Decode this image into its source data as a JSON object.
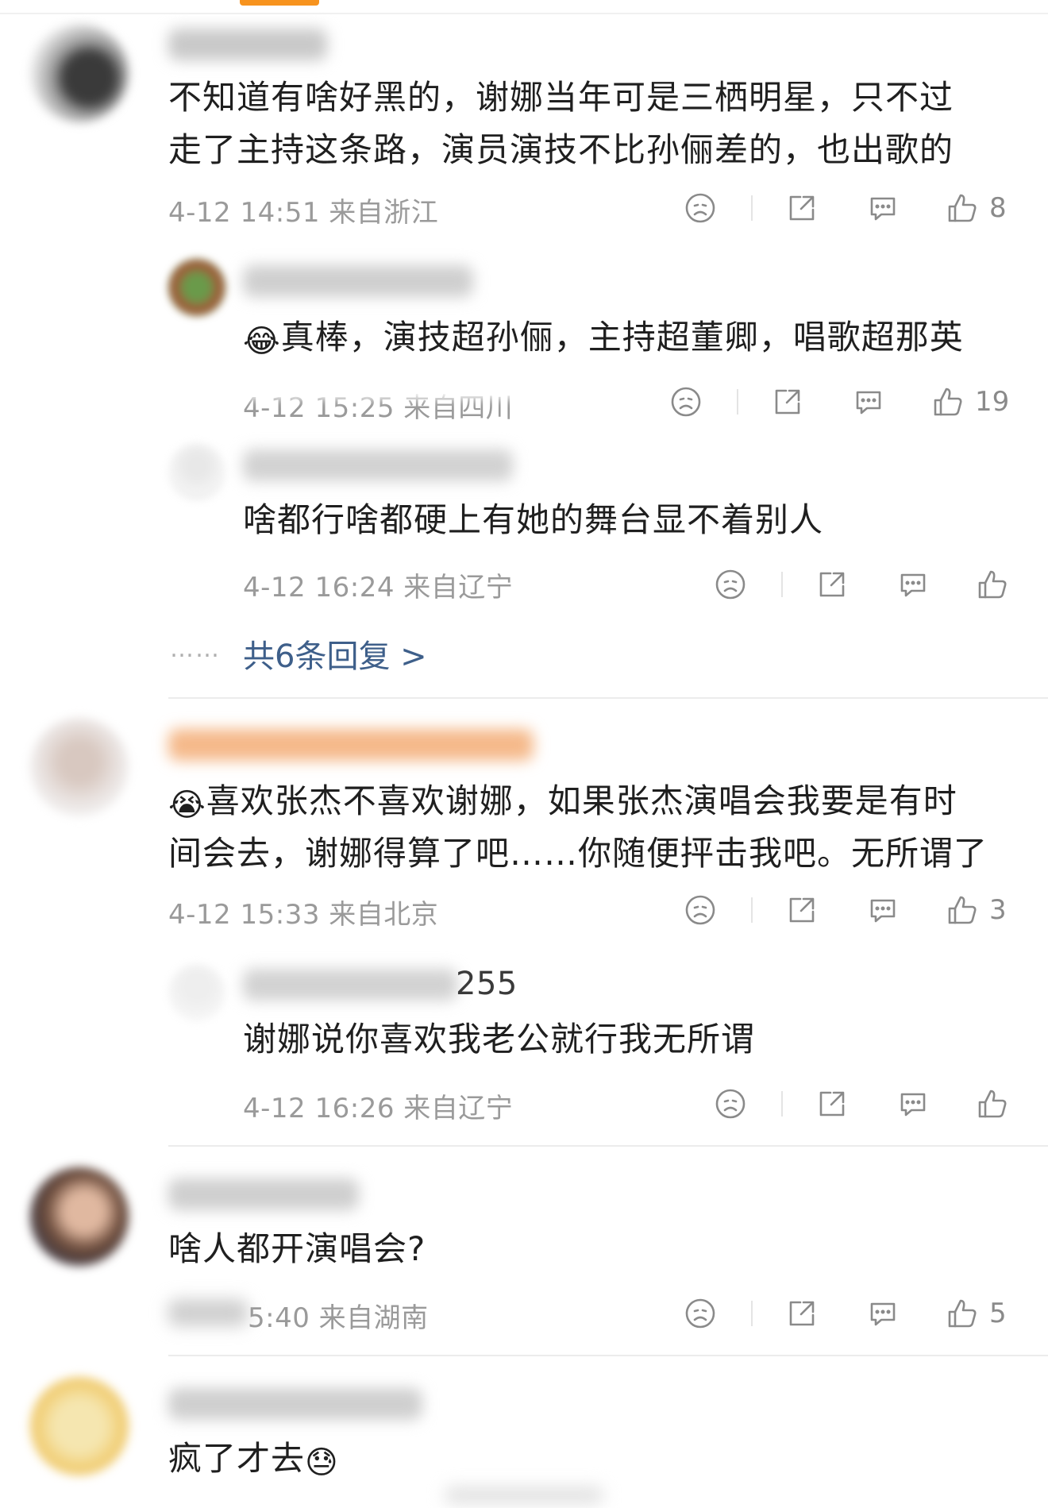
{
  "comments": [
    {
      "text_lines": [
        "不知道有啥好黑的，谢娜当年可是三栖明星，只不过",
        "走了主持这条路，演员演技不比孙俪差的，也出歌的"
      ],
      "meta": "4-12 14:51  来自浙江",
      "likes": "8",
      "replies": [
        {
          "emoji": "😂",
          "text": "真棒，演技超孙俪，主持超董卿，唱歌超那英",
          "meta": "4-12 15:25  来自四川",
          "likes": "19"
        },
        {
          "text": "啥都行啥都硬上有她的舞台显不着别人",
          "meta": "4-12 16:24  来自辽宁",
          "likes": ""
        }
      ],
      "more_replies": "共6条回复 >",
      "more_dots": "……"
    },
    {
      "emoji": "😭",
      "text_lines": [
        "喜欢张杰不喜欢谢娜，如果张杰演唱会我要是有时",
        "间会去，谢娜得算了吧……你随便抨击我吧。无所谓了"
      ],
      "meta": "4-12 15:33  来自北京",
      "likes": "3",
      "replies": [
        {
          "username_tail": "255",
          "text": "谢娜说你喜欢我老公就行我无所谓",
          "meta": "4-12 16:26  来自辽宁",
          "likes": ""
        }
      ]
    },
    {
      "text_lines": [
        "啥人都开演唱会?"
      ],
      "meta": "5:40  来自湖南",
      "likes": "5"
    },
    {
      "text_lines": [
        "疯了才去"
      ],
      "emoji_after": "😓"
    }
  ],
  "icons": [
    "dislike-icon",
    "share-icon",
    "comment-icon",
    "like-icon"
  ],
  "colors": {
    "accent": "#f7931e",
    "link": "#3e5f8a",
    "meta": "#9a9a9a"
  }
}
